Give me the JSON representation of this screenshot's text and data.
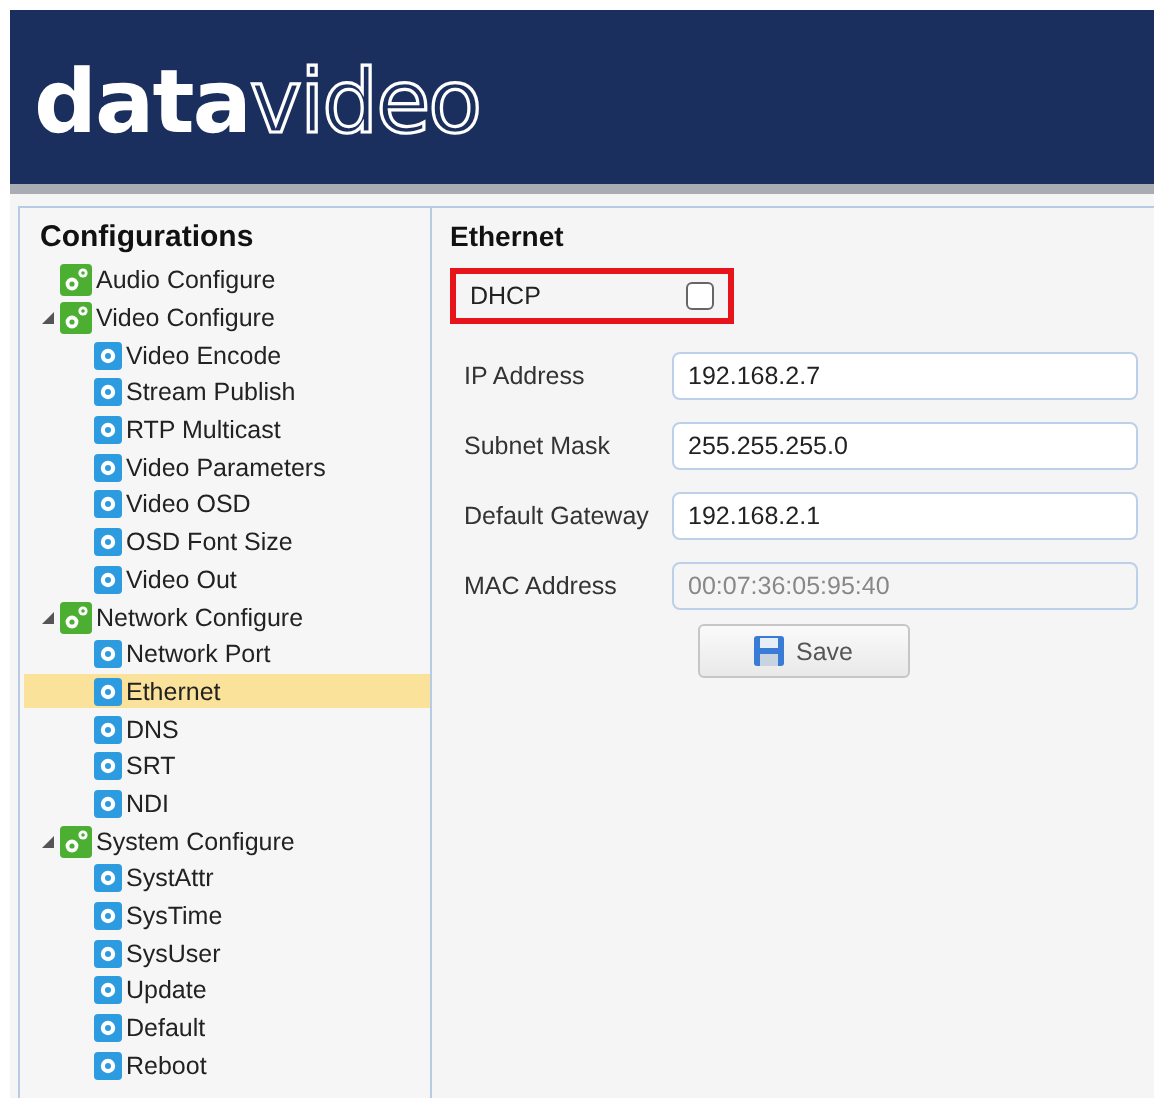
{
  "logo": {
    "solid": "data",
    "outline": "video"
  },
  "sidebar": {
    "title": "Configurations",
    "items": [
      {
        "label": "Audio Configure",
        "kind": "group",
        "expanded": false,
        "selected": false
      },
      {
        "label": "Video Configure",
        "kind": "group",
        "expanded": true,
        "selected": false,
        "children": [
          {
            "label": "Video Encode",
            "kind": "page",
            "selected": false
          },
          {
            "label": "Stream Publish",
            "kind": "page",
            "selected": false
          },
          {
            "label": "RTP Multicast",
            "kind": "page",
            "selected": false
          },
          {
            "label": "Video Parameters",
            "kind": "page",
            "selected": false
          },
          {
            "label": "Video OSD",
            "kind": "page",
            "selected": false
          },
          {
            "label": "OSD Font Size",
            "kind": "page",
            "selected": false
          },
          {
            "label": "Video Out",
            "kind": "page",
            "selected": false
          }
        ]
      },
      {
        "label": "Network Configure",
        "kind": "group",
        "expanded": true,
        "selected": false,
        "children": [
          {
            "label": "Network Port",
            "kind": "page",
            "selected": false
          },
          {
            "label": "Ethernet",
            "kind": "page",
            "selected": true
          },
          {
            "label": "DNS",
            "kind": "page",
            "selected": false
          },
          {
            "label": "SRT",
            "kind": "page",
            "selected": false
          },
          {
            "label": "NDI",
            "kind": "page",
            "selected": false
          }
        ]
      },
      {
        "label": "System Configure",
        "kind": "group",
        "expanded": true,
        "selected": false,
        "children": [
          {
            "label": "SystAttr",
            "kind": "page",
            "selected": false
          },
          {
            "label": "SysTime",
            "kind": "page",
            "selected": false
          },
          {
            "label": "SysUser",
            "kind": "page",
            "selected": false
          },
          {
            "label": "Update",
            "kind": "page",
            "selected": false
          },
          {
            "label": "Default",
            "kind": "page",
            "selected": false
          },
          {
            "label": "Reboot",
            "kind": "page",
            "selected": false
          }
        ]
      }
    ]
  },
  "form": {
    "title": "Ethernet",
    "dhcp": {
      "label": "DHCP",
      "checked": false,
      "highlighted": true
    },
    "fields": [
      {
        "label": "IP Address",
        "value": "192.168.2.7",
        "disabled": false
      },
      {
        "label": "Subnet Mask",
        "value": "255.255.255.0",
        "disabled": false
      },
      {
        "label": "Default Gateway",
        "value": "192.168.2.1",
        "disabled": false
      },
      {
        "label": "MAC Address",
        "value": "00:07:36:05:95:40",
        "disabled": true
      }
    ],
    "save_button": "Save"
  }
}
